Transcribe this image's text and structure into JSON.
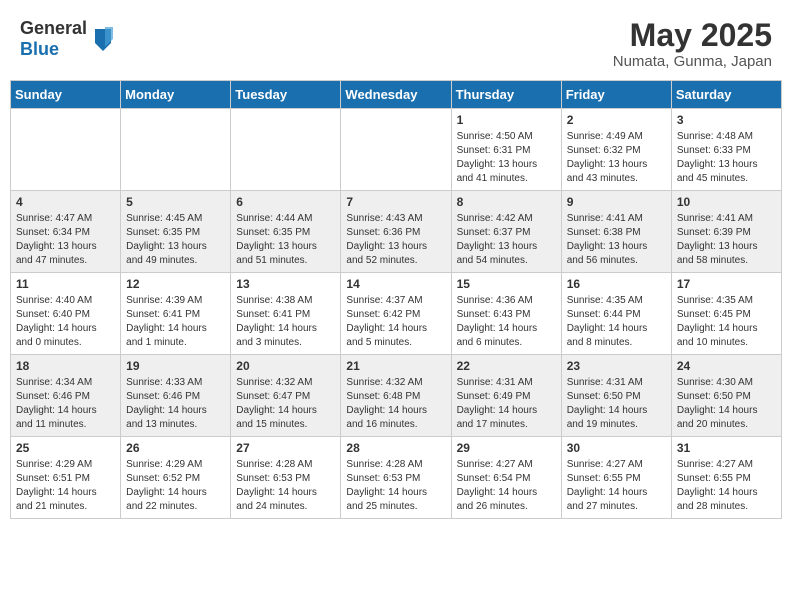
{
  "header": {
    "logo_general": "General",
    "logo_blue": "Blue",
    "month_title": "May 2025",
    "location": "Numata, Gunma, Japan"
  },
  "weekdays": [
    "Sunday",
    "Monday",
    "Tuesday",
    "Wednesday",
    "Thursday",
    "Friday",
    "Saturday"
  ],
  "weeks": [
    [
      {
        "day": "",
        "info": ""
      },
      {
        "day": "",
        "info": ""
      },
      {
        "day": "",
        "info": ""
      },
      {
        "day": "",
        "info": ""
      },
      {
        "day": "1",
        "info": "Sunrise: 4:50 AM\nSunset: 6:31 PM\nDaylight: 13 hours\nand 41 minutes."
      },
      {
        "day": "2",
        "info": "Sunrise: 4:49 AM\nSunset: 6:32 PM\nDaylight: 13 hours\nand 43 minutes."
      },
      {
        "day": "3",
        "info": "Sunrise: 4:48 AM\nSunset: 6:33 PM\nDaylight: 13 hours\nand 45 minutes."
      }
    ],
    [
      {
        "day": "4",
        "info": "Sunrise: 4:47 AM\nSunset: 6:34 PM\nDaylight: 13 hours\nand 47 minutes."
      },
      {
        "day": "5",
        "info": "Sunrise: 4:45 AM\nSunset: 6:35 PM\nDaylight: 13 hours\nand 49 minutes."
      },
      {
        "day": "6",
        "info": "Sunrise: 4:44 AM\nSunset: 6:35 PM\nDaylight: 13 hours\nand 51 minutes."
      },
      {
        "day": "7",
        "info": "Sunrise: 4:43 AM\nSunset: 6:36 PM\nDaylight: 13 hours\nand 52 minutes."
      },
      {
        "day": "8",
        "info": "Sunrise: 4:42 AM\nSunset: 6:37 PM\nDaylight: 13 hours\nand 54 minutes."
      },
      {
        "day": "9",
        "info": "Sunrise: 4:41 AM\nSunset: 6:38 PM\nDaylight: 13 hours\nand 56 minutes."
      },
      {
        "day": "10",
        "info": "Sunrise: 4:41 AM\nSunset: 6:39 PM\nDaylight: 13 hours\nand 58 minutes."
      }
    ],
    [
      {
        "day": "11",
        "info": "Sunrise: 4:40 AM\nSunset: 6:40 PM\nDaylight: 14 hours\nand 0 minutes."
      },
      {
        "day": "12",
        "info": "Sunrise: 4:39 AM\nSunset: 6:41 PM\nDaylight: 14 hours\nand 1 minute."
      },
      {
        "day": "13",
        "info": "Sunrise: 4:38 AM\nSunset: 6:41 PM\nDaylight: 14 hours\nand 3 minutes."
      },
      {
        "day": "14",
        "info": "Sunrise: 4:37 AM\nSunset: 6:42 PM\nDaylight: 14 hours\nand 5 minutes."
      },
      {
        "day": "15",
        "info": "Sunrise: 4:36 AM\nSunset: 6:43 PM\nDaylight: 14 hours\nand 6 minutes."
      },
      {
        "day": "16",
        "info": "Sunrise: 4:35 AM\nSunset: 6:44 PM\nDaylight: 14 hours\nand 8 minutes."
      },
      {
        "day": "17",
        "info": "Sunrise: 4:35 AM\nSunset: 6:45 PM\nDaylight: 14 hours\nand 10 minutes."
      }
    ],
    [
      {
        "day": "18",
        "info": "Sunrise: 4:34 AM\nSunset: 6:46 PM\nDaylight: 14 hours\nand 11 minutes."
      },
      {
        "day": "19",
        "info": "Sunrise: 4:33 AM\nSunset: 6:46 PM\nDaylight: 14 hours\nand 13 minutes."
      },
      {
        "day": "20",
        "info": "Sunrise: 4:32 AM\nSunset: 6:47 PM\nDaylight: 14 hours\nand 15 minutes."
      },
      {
        "day": "21",
        "info": "Sunrise: 4:32 AM\nSunset: 6:48 PM\nDaylight: 14 hours\nand 16 minutes."
      },
      {
        "day": "22",
        "info": "Sunrise: 4:31 AM\nSunset: 6:49 PM\nDaylight: 14 hours\nand 17 minutes."
      },
      {
        "day": "23",
        "info": "Sunrise: 4:31 AM\nSunset: 6:50 PM\nDaylight: 14 hours\nand 19 minutes."
      },
      {
        "day": "24",
        "info": "Sunrise: 4:30 AM\nSunset: 6:50 PM\nDaylight: 14 hours\nand 20 minutes."
      }
    ],
    [
      {
        "day": "25",
        "info": "Sunrise: 4:29 AM\nSunset: 6:51 PM\nDaylight: 14 hours\nand 21 minutes."
      },
      {
        "day": "26",
        "info": "Sunrise: 4:29 AM\nSunset: 6:52 PM\nDaylight: 14 hours\nand 22 minutes."
      },
      {
        "day": "27",
        "info": "Sunrise: 4:28 AM\nSunset: 6:53 PM\nDaylight: 14 hours\nand 24 minutes."
      },
      {
        "day": "28",
        "info": "Sunrise: 4:28 AM\nSunset: 6:53 PM\nDaylight: 14 hours\nand 25 minutes."
      },
      {
        "day": "29",
        "info": "Sunrise: 4:27 AM\nSunset: 6:54 PM\nDaylight: 14 hours\nand 26 minutes."
      },
      {
        "day": "30",
        "info": "Sunrise: 4:27 AM\nSunset: 6:55 PM\nDaylight: 14 hours\nand 27 minutes."
      },
      {
        "day": "31",
        "info": "Sunrise: 4:27 AM\nSunset: 6:55 PM\nDaylight: 14 hours\nand 28 minutes."
      }
    ]
  ]
}
